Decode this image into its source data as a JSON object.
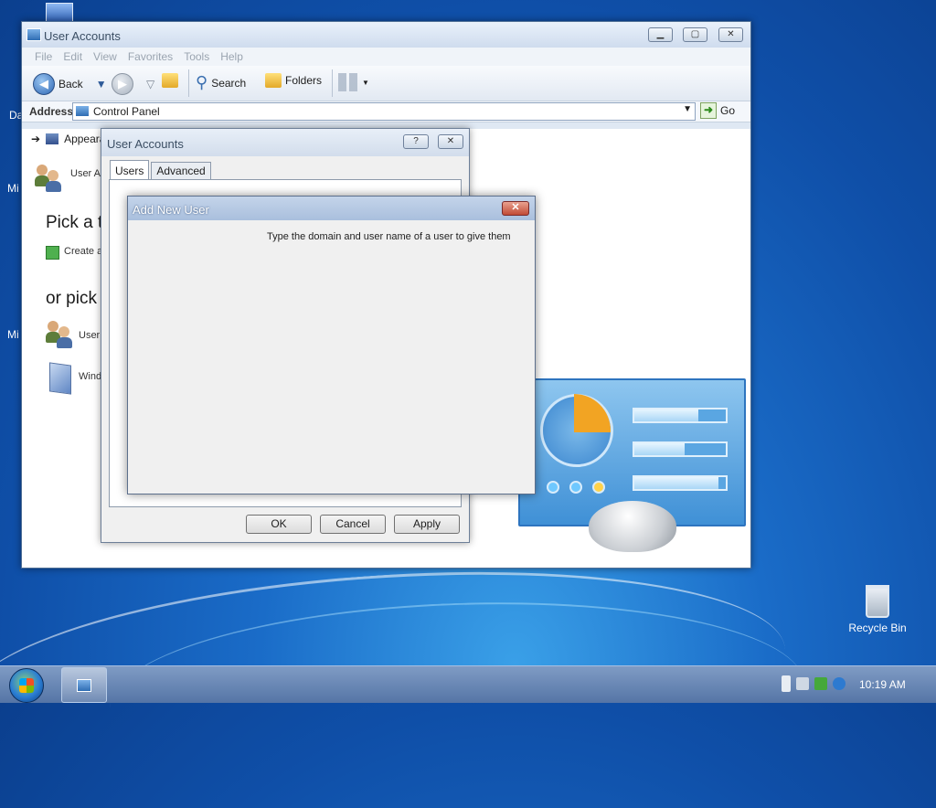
{
  "desktop": {
    "side_labels": [
      "Da",
      "Mi",
      "Mi"
    ],
    "recycle_bin": "Recycle Bin"
  },
  "main_window": {
    "title": "User Accounts",
    "menu": [
      "File",
      "Edit",
      "View",
      "Favorites",
      "Tools",
      "Help"
    ],
    "toolbar": {
      "back": "Back",
      "search": "Search",
      "folders": "Folders"
    },
    "address": {
      "label": "Address",
      "value": "Control Panel",
      "go": "Go"
    },
    "content": {
      "crumb": "Appeara",
      "user_accounts_link": "User A",
      "pick_task": "Pick a t",
      "create_link": "Create a",
      "or_pick": "or pick",
      "user_item": "User",
      "windows_item": "Wind"
    }
  },
  "user_accounts_dialog": {
    "title": "User Accounts",
    "help_glyph": "?",
    "close_glyph": "✕",
    "tabs": [
      "Users",
      "Advanced"
    ],
    "buttons": {
      "ok": "OK",
      "cancel": "Cancel",
      "apply": "Apply"
    }
  },
  "add_new_user_dialog": {
    "title": "Add New User",
    "close_glyph": "✕",
    "instruction": "Type the domain and user name of a user to give them"
  },
  "taskbar": {
    "clock": "10:19 AM"
  },
  "colors": {
    "desktop_blue": "#1a6cc8",
    "accent_orange": "#f2a423",
    "close_red": "#c14b35"
  }
}
